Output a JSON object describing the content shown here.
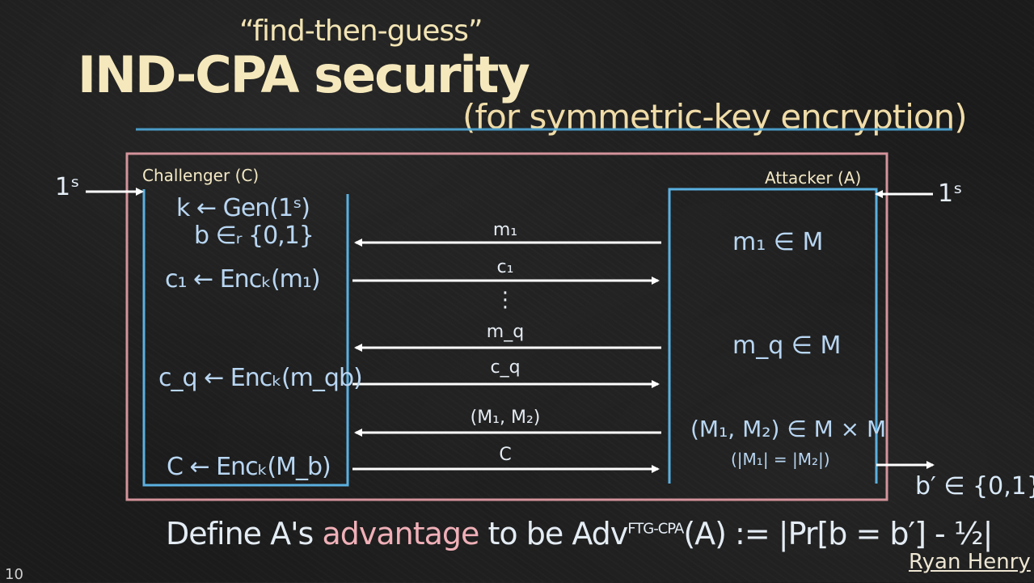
{
  "header": {
    "subtitle": "“find-then-guess”",
    "title": "IND-CPA security",
    "title_parenthetical": "(for symmetric-key encryption)"
  },
  "parties": {
    "challenger_label": "Challenger (C)",
    "attacker_label": "Attacker (A)",
    "security_param_left": "1ˢ",
    "security_param_right": "1ˢ"
  },
  "challenger": {
    "keygen": "k ← Gen(1ˢ)",
    "bit_choice": "b ∈ᵣ {0,1}",
    "enc_1": "c₁ ← Encₖ(m₁)",
    "enc_q": "c_q ← Encₖ(m_qb)",
    "enc_final": "C ← Encₖ(M_b)"
  },
  "attacker": {
    "choose_1": "m₁ ∈ M",
    "choose_q": "m_q ∈ M",
    "choose_pair": "(M₁, M₂) ∈ M × M",
    "pair_condition": "(|M₁| = |M₂|)",
    "output": "b′ ∈ {0,1}"
  },
  "messages": {
    "m1": "m₁",
    "c1": "c₁",
    "ellipsis": "⋮",
    "mq": "m_q",
    "cq": "c_q",
    "pair": "(M₁, M₂)",
    "challenge": "C"
  },
  "footer": {
    "define": "Define A's",
    "advantage_word": "advantage",
    "to_be": "to be",
    "adv": "Adv",
    "adv_superscript": "FTG-CPA",
    "adv_formula": "(A) := |Pr[b = b′] - ½|"
  },
  "author": "Ryan Henry",
  "page_number": "10",
  "colors": {
    "background": "#1b1b1b",
    "outer_box": "#e8a0a8",
    "party_box": "#5ab0e0",
    "title": "#f5e8bc",
    "rule": "#4fa8d8",
    "arrow": "#ffffff"
  }
}
